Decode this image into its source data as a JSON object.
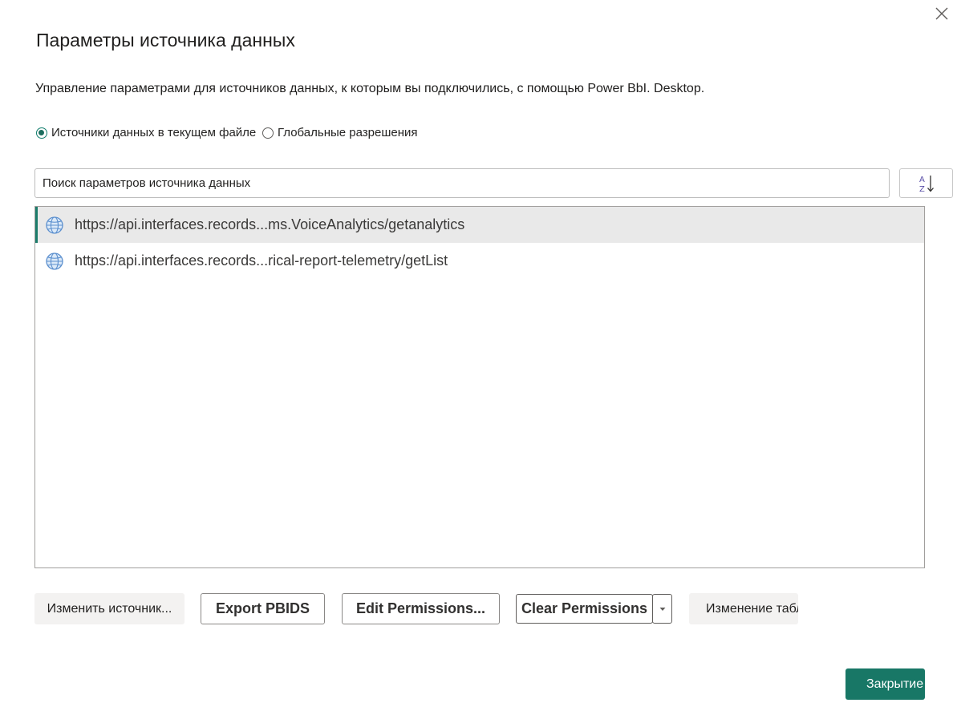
{
  "dialog": {
    "title": "Параметры источника данных",
    "description": "Управление параметрами для источников данных, к которым вы подключились, с помощью Power BbI. Desktop."
  },
  "scope": {
    "options": [
      {
        "label": "Источники данных в текущем файле",
        "selected": true
      },
      {
        "label": "Глобальные разрешения",
        "selected": false
      }
    ]
  },
  "search": {
    "placeholder": "Поиск параметров источника данных",
    "value": ""
  },
  "sort": {
    "icon": "sort-az-icon"
  },
  "sources": [
    {
      "url": "https://api.interfaces.records...ms.VoiceAnalytics/getanalytics",
      "icon": "globe-icon",
      "selected": true
    },
    {
      "url": "https://api.interfaces.records...rical-report-telemetry/getList",
      "icon": "globe-icon",
      "selected": false
    }
  ],
  "actions": {
    "change_source": "Изменить источник...",
    "export_pbids": "Export PBIDS",
    "edit_permissions": "Edit Permissions...",
    "clear_permissions": "Clear Permissions",
    "change_tables": "Изменение таблиц"
  },
  "footer": {
    "close_label": "Закрытие"
  },
  "colors": {
    "accent": "#187766",
    "selected_row": "#e9e9e9",
    "selected_bar": "#1c7c6b"
  }
}
